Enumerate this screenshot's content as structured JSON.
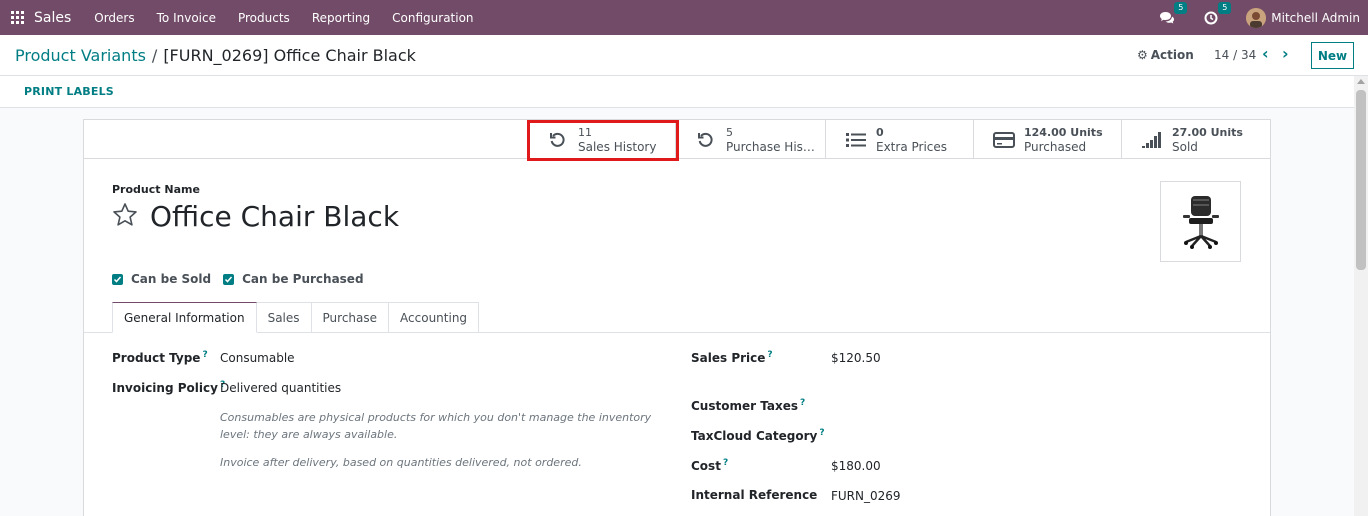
{
  "navbar": {
    "app_name": "Sales",
    "menu": [
      "Orders",
      "To Invoice",
      "Products",
      "Reporting",
      "Configuration"
    ],
    "messages_badge": "5",
    "activities_badge": "5",
    "user_name": "Mitchell Admin",
    "icons": {
      "apps": "apps-grid-icon",
      "messages": "chat-bubbles-icon",
      "activities": "clock-icon"
    }
  },
  "breadcrumb": {
    "parent": "Product Variants",
    "separator": "/",
    "current": "[FURN_0269] Office Chair Black"
  },
  "control": {
    "action_label": "Action",
    "pager": "14 / 34",
    "new_label": "New"
  },
  "buttonbar": {
    "print_labels": "PRINT LABELS"
  },
  "stats": [
    {
      "value": "11",
      "label": "Sales History",
      "icon": "history-icon"
    },
    {
      "value": "5",
      "label": "Purchase Hist...",
      "icon": "history-icon"
    },
    {
      "value": "0",
      "label": "Extra Prices",
      "icon": "list-icon"
    },
    {
      "value": "124.00 Units",
      "label": "Purchased",
      "icon": "credit-card-icon"
    },
    {
      "value": "27.00 Units",
      "label": "Sold",
      "icon": "signal-bars-icon"
    }
  ],
  "product": {
    "name_caption": "Product Name",
    "name": "Office Chair Black",
    "can_be_sold": "Can be Sold",
    "can_be_purchased": "Can be Purchased"
  },
  "tabs": [
    "General Information",
    "Sales",
    "Purchase",
    "Accounting"
  ],
  "general": {
    "product_type_label": "Product Type",
    "product_type": "Consumable",
    "invoicing_policy_label": "Invoicing Policy",
    "invoicing_policy": "Delivered quantities",
    "help_consumable": "Consumables are physical products for which you don't manage the inventory level: they are always available.",
    "help_invoice": "Invoice after delivery, based on quantities delivered, not ordered.",
    "sales_price_label": "Sales Price",
    "sales_price": "$120.50",
    "customer_taxes_label": "Customer Taxes",
    "taxcloud_label": "TaxCloud Category",
    "cost_label": "Cost",
    "cost": "$180.00",
    "internal_ref_label": "Internal Reference",
    "internal_ref": "FURN_0269"
  },
  "colors": {
    "brand": "#714b67",
    "accent": "#017e84",
    "highlight": "#e0191b"
  }
}
